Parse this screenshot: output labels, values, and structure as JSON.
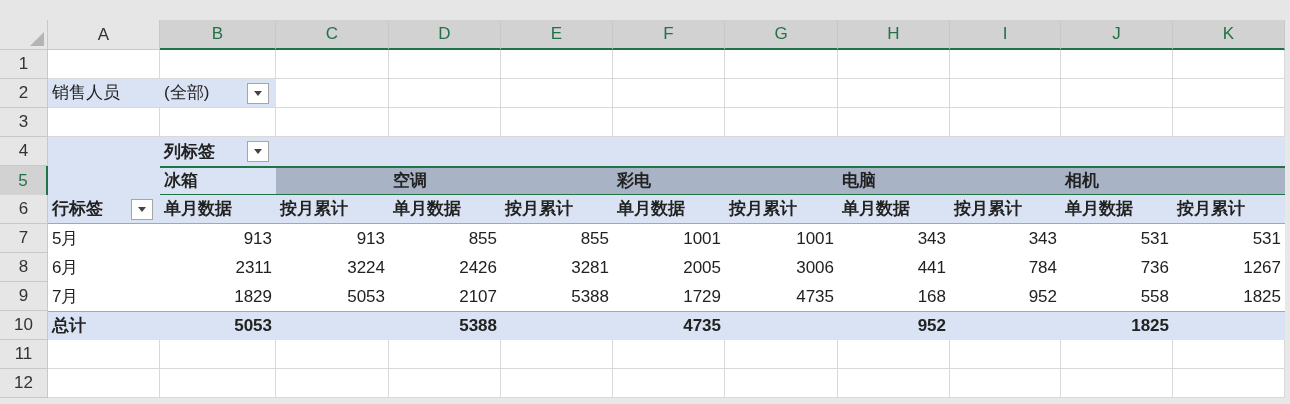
{
  "column_headers": [
    {
      "label": "A",
      "selected": false
    },
    {
      "label": "B",
      "selected": true
    },
    {
      "label": "C",
      "selected": true
    },
    {
      "label": "D",
      "selected": true
    },
    {
      "label": "E",
      "selected": true
    },
    {
      "label": "F",
      "selected": true
    },
    {
      "label": "G",
      "selected": true
    },
    {
      "label": "H",
      "selected": true
    },
    {
      "label": "I",
      "selected": true
    },
    {
      "label": "J",
      "selected": true
    },
    {
      "label": "K",
      "selected": true
    }
  ],
  "rows": [
    {
      "number": "1",
      "selected": false,
      "kind": "blank",
      "cells": [
        {},
        {},
        {},
        {},
        {},
        {},
        {},
        {},
        {},
        {},
        {}
      ]
    },
    {
      "number": "2",
      "selected": false,
      "kind": "filter",
      "cells": [
        {
          "text": "销售人员"
        },
        {
          "text": "(全部)",
          "dropdown": true
        },
        {},
        {},
        {},
        {},
        {},
        {},
        {},
        {},
        {}
      ]
    },
    {
      "number": "3",
      "selected": false,
      "kind": "blank",
      "cells": [
        {},
        {},
        {},
        {},
        {},
        {},
        {},
        {},
        {},
        {},
        {}
      ]
    },
    {
      "number": "4",
      "selected": false,
      "kind": "pivot_header",
      "cells": [
        {},
        {
          "text": "列标签",
          "dropdown": true
        },
        {},
        {},
        {},
        {},
        {},
        {},
        {},
        {},
        {}
      ]
    },
    {
      "number": "5",
      "selected": true,
      "kind": "pivot_header",
      "cells": [
        {
          "selected": false
        },
        {
          "text": "冰箱",
          "selected": true,
          "active": true
        },
        {
          "selected": true
        },
        {
          "text": "空调",
          "selected": true
        },
        {
          "selected": true
        },
        {
          "text": "彩电",
          "selected": true
        },
        {
          "selected": true
        },
        {
          "text": "电脑",
          "selected": true
        },
        {
          "selected": true
        },
        {
          "text": "相机",
          "selected": true
        },
        {
          "selected": true
        }
      ]
    },
    {
      "number": "6",
      "selected": false,
      "kind": "field_headers",
      "cells": [
        {
          "text": "行标签",
          "dropdown": true
        },
        {
          "text": "单月数据"
        },
        {
          "text": "按月累计"
        },
        {
          "text": "单月数据"
        },
        {
          "text": "按月累计"
        },
        {
          "text": "单月数据"
        },
        {
          "text": "按月累计"
        },
        {
          "text": "单月数据"
        },
        {
          "text": "按月累计"
        },
        {
          "text": "单月数据"
        },
        {
          "text": "按月累计"
        }
      ]
    },
    {
      "number": "7",
      "selected": false,
      "kind": "data",
      "cells": [
        {
          "text": "5月"
        },
        {
          "text": "913"
        },
        {
          "text": "913"
        },
        {
          "text": "855"
        },
        {
          "text": "855"
        },
        {
          "text": "1001"
        },
        {
          "text": "1001"
        },
        {
          "text": "343"
        },
        {
          "text": "343"
        },
        {
          "text": "531"
        },
        {
          "text": "531"
        }
      ]
    },
    {
      "number": "8",
      "selected": false,
      "kind": "data",
      "cells": [
        {
          "text": "6月"
        },
        {
          "text": "2311"
        },
        {
          "text": "3224"
        },
        {
          "text": "2426"
        },
        {
          "text": "3281"
        },
        {
          "text": "2005"
        },
        {
          "text": "3006"
        },
        {
          "text": "441"
        },
        {
          "text": "784"
        },
        {
          "text": "736"
        },
        {
          "text": "1267"
        }
      ]
    },
    {
      "number": "9",
      "selected": false,
      "kind": "data",
      "cells": [
        {
          "text": "7月"
        },
        {
          "text": "1829"
        },
        {
          "text": "5053"
        },
        {
          "text": "2107"
        },
        {
          "text": "5388"
        },
        {
          "text": "1729"
        },
        {
          "text": "4735"
        },
        {
          "text": "168"
        },
        {
          "text": "952"
        },
        {
          "text": "558"
        },
        {
          "text": "1825"
        }
      ]
    },
    {
      "number": "10",
      "selected": false,
      "kind": "total",
      "cells": [
        {
          "text": "总计"
        },
        {
          "text": "5053"
        },
        {},
        {
          "text": "5388"
        },
        {},
        {
          "text": "4735"
        },
        {},
        {
          "text": "952"
        },
        {},
        {
          "text": "1825"
        },
        {}
      ]
    },
    {
      "number": "11",
      "selected": false,
      "kind": "blank",
      "cells": [
        {},
        {},
        {},
        {},
        {},
        {},
        {},
        {},
        {},
        {},
        {}
      ]
    },
    {
      "number": "12",
      "selected": false,
      "kind": "blank",
      "cells": [
        {},
        {},
        {},
        {},
        {},
        {},
        {},
        {},
        {},
        {},
        {}
      ]
    }
  ]
}
